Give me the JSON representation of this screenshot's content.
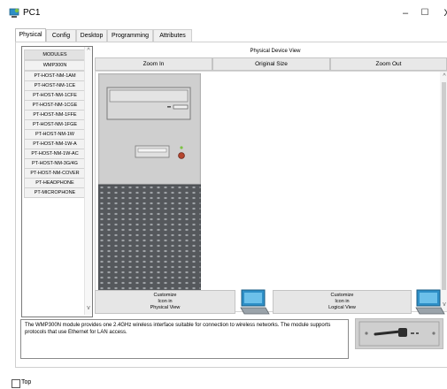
{
  "window": {
    "title": "PC1",
    "controls": {
      "minimize": "–",
      "maximize": "☐",
      "close": "X"
    }
  },
  "tabs": [
    {
      "label": "Physical",
      "active": true
    },
    {
      "label": "Config",
      "active": false
    },
    {
      "label": "Desktop",
      "active": false
    },
    {
      "label": "Programming",
      "active": false
    },
    {
      "label": "Attributes",
      "active": false
    }
  ],
  "modules": {
    "header": "MODULES",
    "items": [
      "WMP300N",
      "PT-HOST-NM-1AM",
      "PT-HOST-NM-1CE",
      "PT-HOST-NM-1CFE",
      "PT-HOST-NM-1CGE",
      "PT-HOST-NM-1FFE",
      "PT-HOST-NM-1FGE",
      "PT-HOST-NM-1W",
      "PT-HOST-NM-1W-A",
      "PT-HOST-NM-1W-AC",
      "PT-HOST-NM-3G/4G",
      "PT-HOST-NM-COVER",
      "PT-HEADPHONE",
      "PT-MICROPHONE"
    ]
  },
  "physical_view": {
    "title": "Physical Device View",
    "zoom_in": "Zoom In",
    "original_size": "Original Size",
    "zoom_out": "Zoom Out"
  },
  "customize": {
    "physical": [
      "Customize",
      "Icon in",
      "Physical View"
    ],
    "logical": [
      "Customize",
      "Icon in",
      "Logical View"
    ]
  },
  "description": "The WMP300N module provides one 2.4GHz wireless interface suitable for connection to wireless networks. The module supports protocols that use Ethernet for LAN access.",
  "footer": {
    "top_label": "Top",
    "top_checked": false
  },
  "colors": {
    "pc_body": "#c8c8c8",
    "pc_grille": "#505050",
    "power_led": "#c0392b",
    "icon_blue": "#2e8fc7"
  }
}
